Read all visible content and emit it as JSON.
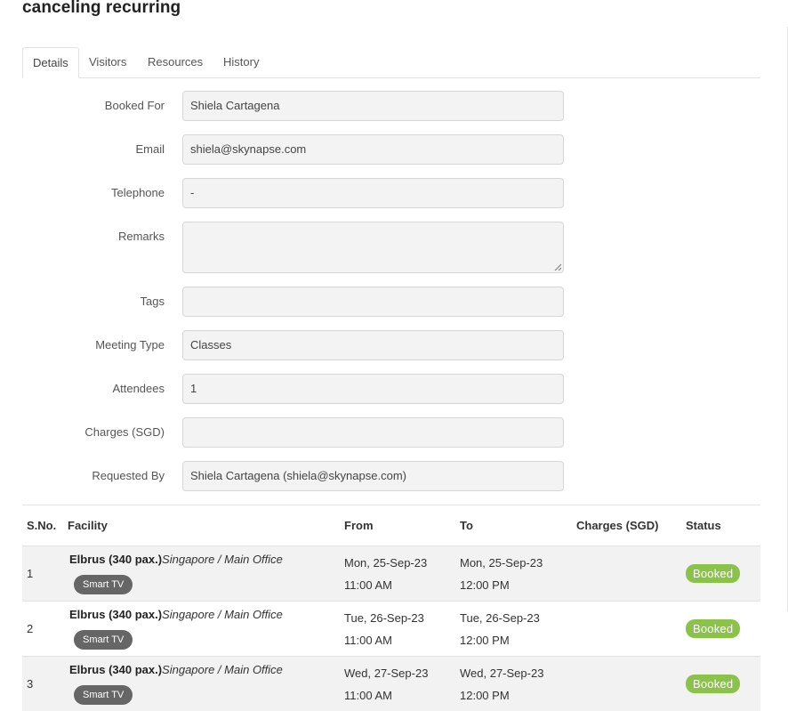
{
  "page": {
    "title": "canceling recurring"
  },
  "tabs": [
    {
      "label": "Details",
      "active": true
    },
    {
      "label": "Visitors",
      "active": false
    },
    {
      "label": "Resources",
      "active": false
    },
    {
      "label": "History",
      "active": false
    }
  ],
  "form": {
    "booked_for": {
      "label": "Booked For",
      "value": "Shiela Cartagena"
    },
    "email": {
      "label": "Email",
      "value": "shiela@skynapse.com"
    },
    "telephone": {
      "label": "Telephone",
      "value": "-"
    },
    "remarks": {
      "label": "Remarks",
      "value": ""
    },
    "tags": {
      "label": "Tags",
      "value": ""
    },
    "meeting_type": {
      "label": "Meeting Type",
      "value": "Classes"
    },
    "attendees": {
      "label": "Attendees",
      "value": "1"
    },
    "charges": {
      "label": "Charges (SGD)",
      "value": ""
    },
    "requested_by": {
      "label": "Requested By",
      "value": "Shiela Cartagena (shiela@skynapse.com)"
    }
  },
  "table": {
    "headers": {
      "sno": "S.No.",
      "facility": "Facility",
      "from": "From",
      "to": "To",
      "charges": "Charges (SGD)",
      "status": "Status"
    },
    "rows": [
      {
        "sno": "1",
        "facility": "Elbrus (340 pax.)",
        "location": "Singapore / Main Office",
        "resource": "Smart TV",
        "from_date": "Mon, 25-Sep-23",
        "from_time": "11:00 AM",
        "to_date": "Mon, 25-Sep-23",
        "to_time": "12:00 PM",
        "charges": "",
        "status": "Booked"
      },
      {
        "sno": "2",
        "facility": "Elbrus (340 pax.)",
        "location": "Singapore / Main Office",
        "resource": "Smart TV",
        "from_date": "Tue, 26-Sep-23",
        "from_time": "11:00 AM",
        "to_date": "Tue, 26-Sep-23",
        "to_time": "12:00 PM",
        "charges": "",
        "status": "Booked"
      },
      {
        "sno": "3",
        "facility": "Elbrus (340 pax.)",
        "location": "Singapore / Main Office",
        "resource": "Smart TV",
        "from_date": "Wed, 27-Sep-23",
        "from_time": "11:00 AM",
        "to_date": "Wed, 27-Sep-23",
        "to_time": "12:00 PM",
        "charges": "",
        "status": "Booked"
      }
    ]
  },
  "colors": {
    "status_booked": "#8bc34a",
    "resource_chip": "#666666",
    "field_background": "#f3f3f3"
  }
}
